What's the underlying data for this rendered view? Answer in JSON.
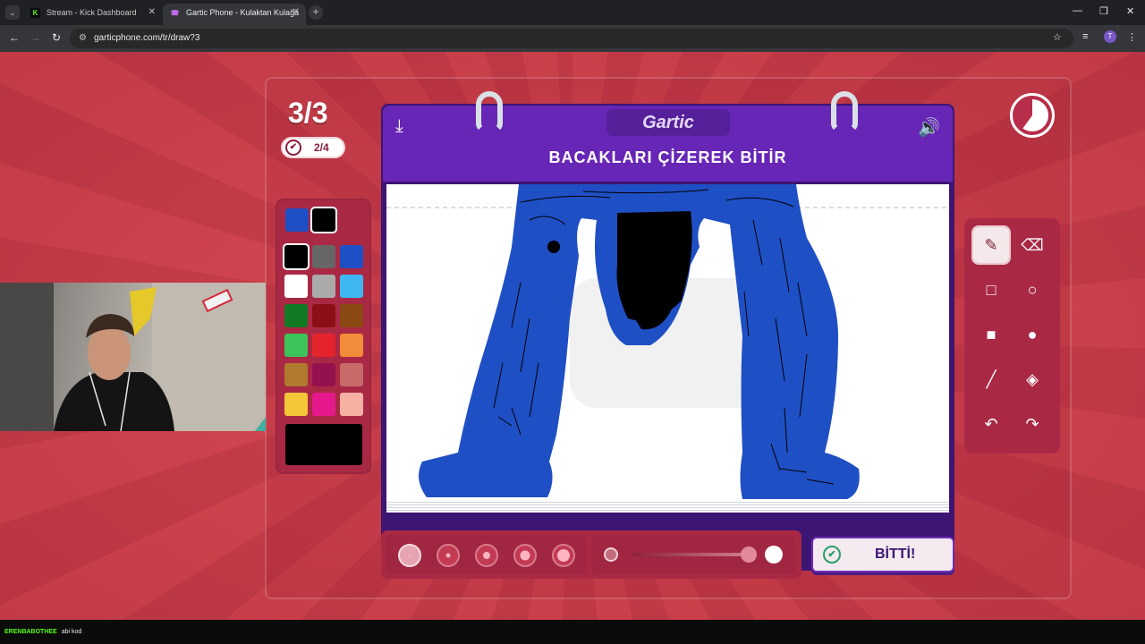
{
  "browser": {
    "tabs": [
      {
        "title": "Stream - Kick Dashboard",
        "favicon": "kick-icon",
        "active": false
      },
      {
        "title": "Gartic Phone - Kulaktan Kulağa",
        "favicon": "gartic-icon",
        "active": true
      }
    ],
    "url": "garticphone.com/tr/draw?3"
  },
  "game": {
    "round": "3/3",
    "done_count": "2/4",
    "logo": "Gartic",
    "prompt": "BACAKLARI ÇİZEREK BİTİR",
    "done_button": "BİTTİ!",
    "timer_remaining": 0.6,
    "palette": {
      "primary": "#1f4fc4",
      "secondary": "#000000",
      "colors": [
        "#000000",
        "#666666",
        "#1f4fc4",
        "#ffffff",
        "#aaaaaa",
        "#3fb8f2",
        "#127a23",
        "#8c0f15",
        "#8b4a13",
        "#3cc45a",
        "#e5232c",
        "#f08c3a",
        "#b07a2e",
        "#93124d",
        "#c96a6a",
        "#f5c53a",
        "#e6198c",
        "#f7b1a3"
      ]
    },
    "tools": [
      "pencil-icon",
      "eraser-icon",
      "rectangle-outline-icon",
      "circle-outline-icon",
      "rectangle-filled-icon",
      "circle-filled-icon",
      "line-icon",
      "bucket-icon",
      "undo-icon",
      "redo-icon"
    ],
    "brush_sizes": 5,
    "selected_size": 0
  },
  "chat": {
    "user": "ERENBABOTHEE",
    "message": "abi kod"
  }
}
